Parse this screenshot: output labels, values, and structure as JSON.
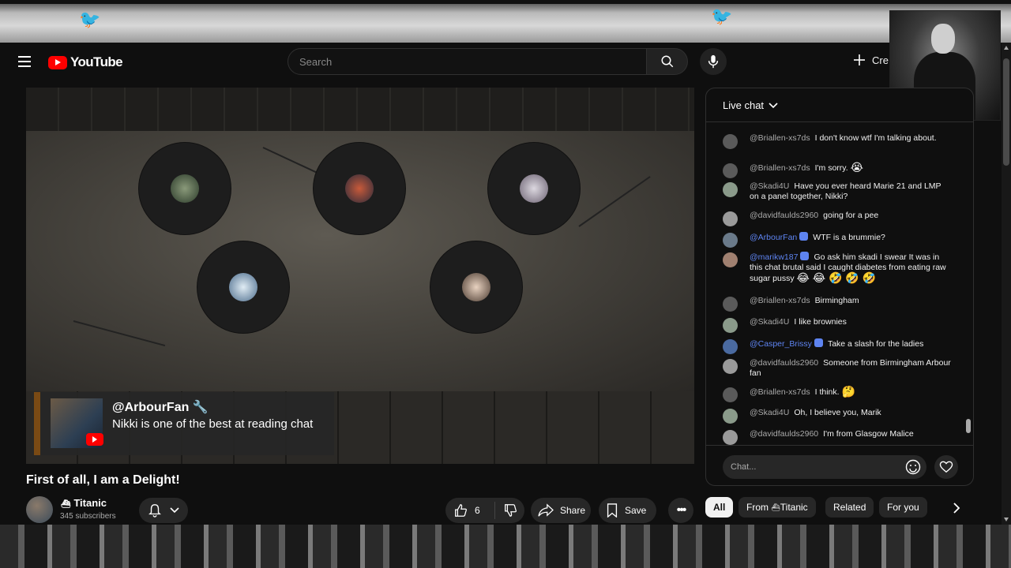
{
  "masthead": {
    "logo_text": "YouTube",
    "search_placeholder": "Search",
    "create_label": "Cre"
  },
  "video": {
    "overlay_author": "@ArbourFan",
    "overlay_message": "Nikki is one of the best at reading chat",
    "title": "First of all, I am a Delight!",
    "channel_name": "Titanic",
    "subscribers": "345 subscribers",
    "like_count": "6",
    "share_label": "Share",
    "save_label": "Save"
  },
  "chat": {
    "header": "Live chat",
    "input_placeholder": "Chat...",
    "messages": [
      {
        "author": "@Briallen-xs7ds",
        "text": "I don't know wtf I'm talking about.",
        "emoji": "",
        "mod": false
      },
      {
        "author": "@Briallen-xs7ds",
        "text": "I'm sorry.",
        "emoji": "😭",
        "mod": false
      },
      {
        "author": "@Skadi4U",
        "text": "Have you ever heard Marie 21 and LMP on a panel together, Nikki?",
        "emoji": "",
        "mod": false
      },
      {
        "author": "@davidfaulds2960",
        "text": "going for a pee",
        "emoji": "",
        "mod": false
      },
      {
        "author": "@ArbourFan",
        "text": "WTF is a brummie?",
        "emoji": "",
        "mod": true
      },
      {
        "author": "@marikw187",
        "text": "Go ask him skadi I swear It was in this chat brutal said I caught diabetes from eating raw sugar pussy",
        "emoji": "😂 😂 🤣 🤣 🤣",
        "mod": true
      },
      {
        "author": "@Briallen-xs7ds",
        "text": "Birmingham",
        "emoji": "",
        "mod": false
      },
      {
        "author": "@Skadi4U",
        "text": "I like brownies",
        "emoji": "",
        "mod": false
      },
      {
        "author": "@Casper_Brissy",
        "text": "Take a slash for the ladies",
        "emoji": "",
        "mod": true
      },
      {
        "author": "@davidfaulds2960",
        "text": "Someone from Birmingham Arbour fan",
        "emoji": "",
        "mod": false
      },
      {
        "author": "@Briallen-xs7ds",
        "text": "I think.",
        "emoji": "🤔",
        "mod": false
      },
      {
        "author": "@Skadi4U",
        "text": "Oh, I believe you, Marik",
        "emoji": "",
        "mod": false
      },
      {
        "author": "@davidfaulds2960",
        "text": "I'm from Glasgow Malice",
        "emoji": "",
        "mod": false
      }
    ]
  },
  "chips": {
    "all": "All",
    "from_prefix": "From",
    "from_channel": "Titanic",
    "related": "Related",
    "for_you": "For you"
  },
  "colors": {
    "brand_red": "#ff0000",
    "mod_blue": "#5e84f1",
    "background": "#0f0f0f",
    "surface": "#272727"
  },
  "icons": [
    "menu-icon",
    "youtube-logo-icon",
    "search-icon",
    "mic-icon",
    "plus-icon",
    "bell-icon",
    "chevron-down-icon",
    "thumbs-up-icon",
    "thumbs-down-icon",
    "share-icon",
    "bookmark-icon",
    "more-icon",
    "emoji-icon",
    "heart-icon",
    "chevron-right-icon",
    "verified-badge-icon"
  ]
}
